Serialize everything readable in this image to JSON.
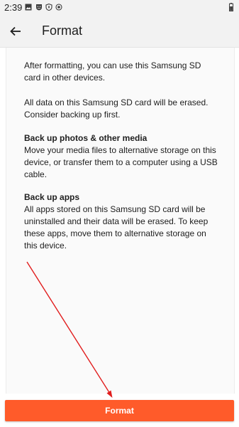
{
  "status_bar": {
    "time": "2:39",
    "icons": [
      "image-icon",
      "shield-face-icon",
      "shield-lock-icon",
      "record-circle-icon"
    ],
    "battery": "battery-icon"
  },
  "app_bar": {
    "title": "Format",
    "back_icon": "arrow-left-icon"
  },
  "content": {
    "intro": "After formatting, you can use this Samsung SD card in other devices.",
    "warning": "All data on this Samsung SD card will be erased. Consider backing up first.",
    "sections": [
      {
        "heading": "Back up photos & other media",
        "body": "Move your media files to alternative storage on this device, or transfer them to a computer using a USB cable."
      },
      {
        "heading": "Back up apps",
        "body": "All apps stored on this Samsung SD card will be uninstalled and their data will be erased. To keep these apps, move them to alternative storage on this device."
      }
    ]
  },
  "actions": {
    "format_label": "Format"
  },
  "colors": {
    "accent": "#ff5b2a",
    "annotation": "#e11d1d"
  }
}
